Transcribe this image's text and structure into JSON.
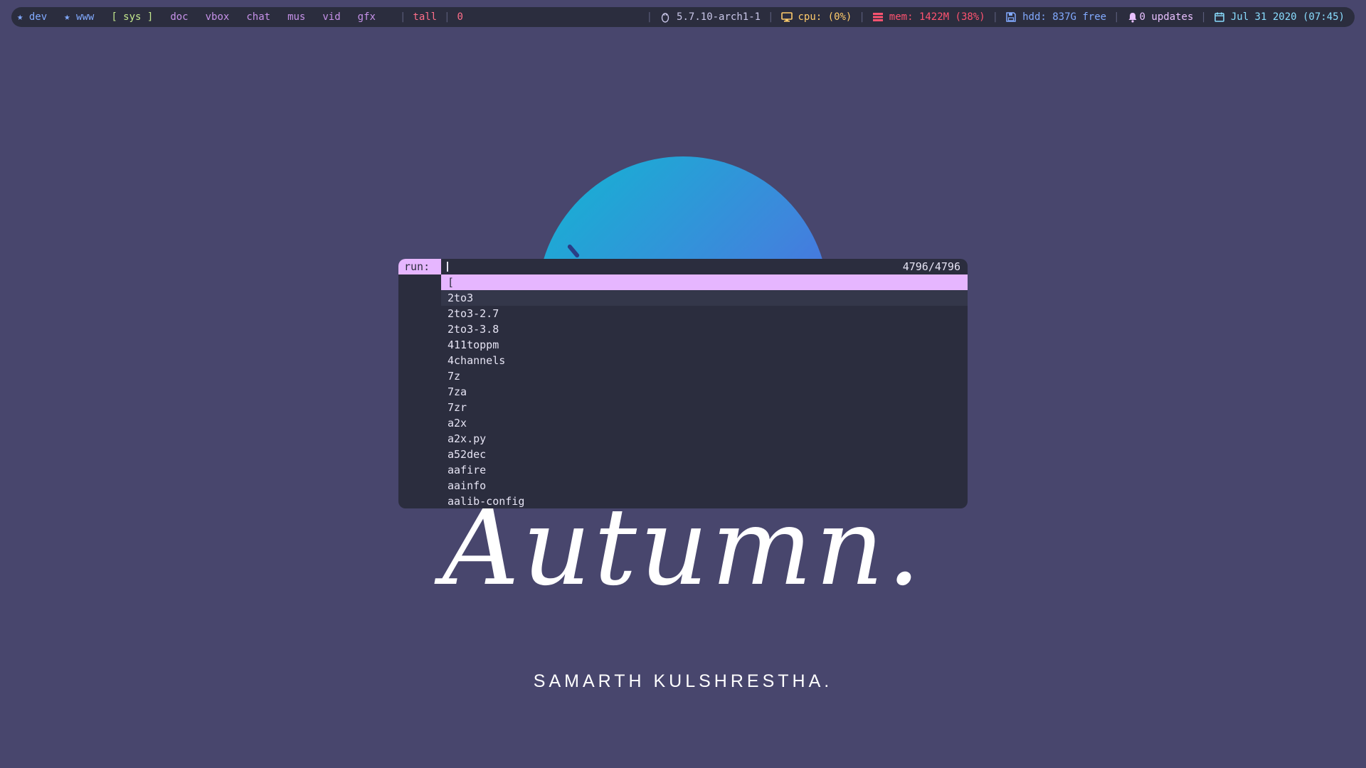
{
  "topbar": {
    "workspaces": [
      {
        "label": "★ dev",
        "state": "occupied"
      },
      {
        "label": "★ www",
        "state": "occupied"
      },
      {
        "label": "[ sys ]",
        "state": "active"
      },
      {
        "label": "doc",
        "state": "empty"
      },
      {
        "label": "vbox",
        "state": "empty"
      },
      {
        "label": "chat",
        "state": "empty"
      },
      {
        "label": "mus",
        "state": "empty"
      },
      {
        "label": "vid",
        "state": "empty"
      },
      {
        "label": "gfx",
        "state": "empty"
      }
    ],
    "separator": "|",
    "layout": "tall",
    "window_count": "0",
    "kernel": "5.7.10-arch1-1",
    "cpu": "cpu: (0%)",
    "mem": "mem: 1422M (38%)",
    "hdd": "hdd: 837G free",
    "updates": "0 updates",
    "clock": "Jul 31 2020 (07:45)",
    "icons": {
      "kernel": "linux-penguin-icon",
      "cpu": "monitor-icon",
      "mem": "memory-icon",
      "hdd": "floppy-disk-icon",
      "updates": "bell-icon",
      "clock": "calendar-icon"
    },
    "colors": {
      "bar_bg": "#2b2d3e",
      "workspace_occupied": "#82aaff",
      "workspace_active": "#c3e88d",
      "workspace_empty": "#c792ea",
      "layout": "#ff6f8a",
      "cpu": "#ffcb6b",
      "mem": "#ff5370",
      "hdd": "#82aaff",
      "updates": "#e8c0ff",
      "clock": "#89ddff"
    }
  },
  "launcher": {
    "prompt": "run:",
    "input_value": "",
    "match_count": "4796/4796",
    "items": [
      "[",
      "2to3",
      "2to3-2.7",
      "2to3-3.8",
      "411toppm",
      "4channels",
      "7z",
      "7za",
      "7zr",
      "a2x",
      "a2x.py",
      "a52dec",
      "aafire",
      "aainfo",
      "aalib-config"
    ],
    "selected_index": 0,
    "hover_index": 1,
    "colors": {
      "background": "#2b2d3e",
      "highlight": "#e6b6ff",
      "text": "#e6e4f4"
    }
  },
  "wallpaper": {
    "title": "Autumn.",
    "author": "SAMARTH KULSHRESTHA.",
    "colors": {
      "background": "#48466d",
      "sun_start": "#12b6d2",
      "sun_end": "#5957e6"
    }
  }
}
